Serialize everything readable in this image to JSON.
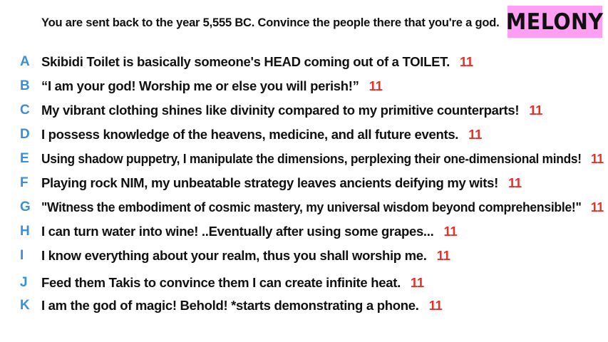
{
  "prompt": "You are sent back to the year 5,555 BC. Convince the people there that you're a god.",
  "player": {
    "name": "MELONY",
    "badge_color": "#ff9ff3"
  },
  "colors": {
    "letter": "#3b8fd9",
    "score": "#e8302a",
    "text": "#111111"
  },
  "answers": [
    {
      "letter": "A",
      "text": "Skibidi Toilet is basically someone's HEAD coming out of a TOILET.",
      "score": "11"
    },
    {
      "letter": "B",
      "text": "“I am your god! Worship me or else you will perish!”",
      "score": "11"
    },
    {
      "letter": "C",
      "text": "My vibrant clothing shines like divinity compared to my primitive counterparts!",
      "score": "11"
    },
    {
      "letter": "D",
      "text": "I possess knowledge of the heavens, medicine, and all future events.",
      "score": "11"
    },
    {
      "letter": "E",
      "text": "Using shadow puppetry, I manipulate the dimensions, perplexing their one-dimensional minds!",
      "score": "11"
    },
    {
      "letter": "F",
      "text": "Playing rock NIM, my unbeatable strategy leaves ancients deifying my wits!",
      "score": "11"
    },
    {
      "letter": "G",
      "text": "\"Witness the embodiment of cosmic mastery, my universal wisdom beyond comprehensible!\"",
      "score": "11"
    },
    {
      "letter": "H",
      "text": "I can turn water into wine! ..Eventually after using some grapes...",
      "score": "11"
    },
    {
      "letter": "I",
      "text": "I know everything about your realm, thus you shall worship me.",
      "score": "11"
    },
    {
      "letter": "J",
      "text": "Feed them Takis to convince them I can create infinite heat.",
      "score": "11"
    },
    {
      "letter": "K",
      "text": "I am the god of magic! Behold! *starts demonstrating a phone.",
      "score": "11"
    }
  ]
}
